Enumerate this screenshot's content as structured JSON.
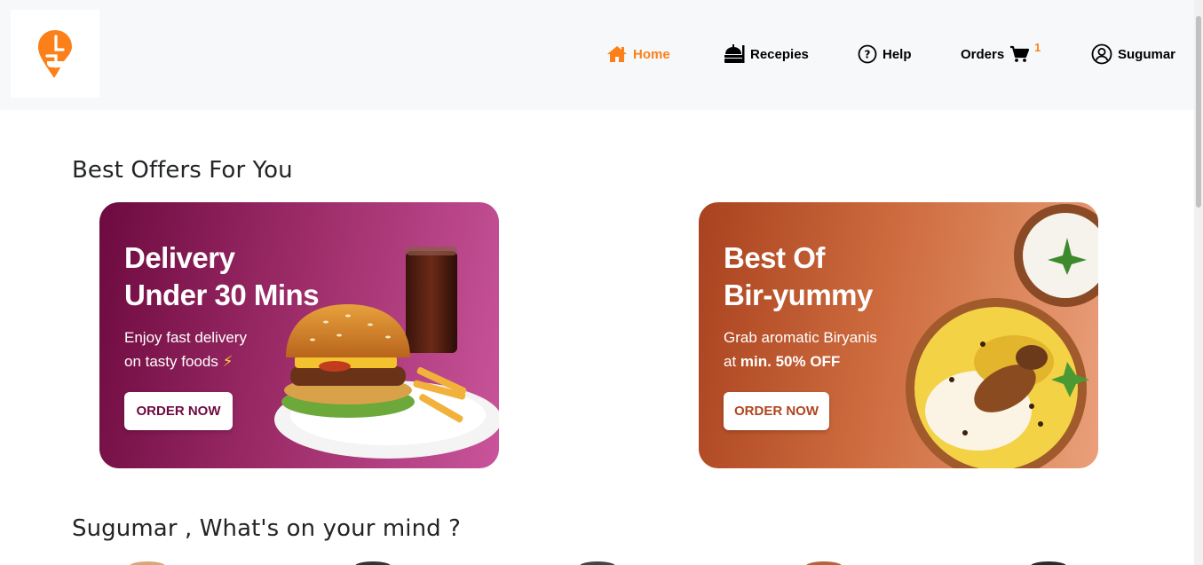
{
  "header": {
    "logo_icon": "swiggy-logo-icon",
    "nav": {
      "home": "Home",
      "recipes": "Recepies",
      "help": "Help",
      "orders": "Orders",
      "cart_count": "1",
      "user": "Sugumar"
    }
  },
  "sections": {
    "offers_title": "Best Offers For You",
    "mind_title": "Sugumar , What's on your mind ?"
  },
  "offers": [
    {
      "headline_line1": "Delivery",
      "headline_line2": "Under 30 Mins",
      "sub_line1": "Enjoy fast delivery",
      "sub_line2": "on tasty foods",
      "sub_icon": "lightning-icon",
      "button": "ORDER NOW",
      "image": "burger-and-cola-illustration"
    },
    {
      "headline_line1": "Best Of",
      "headline_line2": "Bir-yummy",
      "sub_line1": "Grab aromatic Biryanis",
      "sub_line2_prefix": "at ",
      "sub_line2_bold": "min. 50% OFF",
      "button": "ORDER NOW",
      "image": "biryani-and-raita-illustration"
    }
  ],
  "colors": {
    "accent": "#fc8019",
    "offer1_gradient": [
      "#6d0a3f",
      "#c9549b"
    ],
    "offer2_gradient": [
      "#a9421f",
      "#eaa07a"
    ]
  }
}
